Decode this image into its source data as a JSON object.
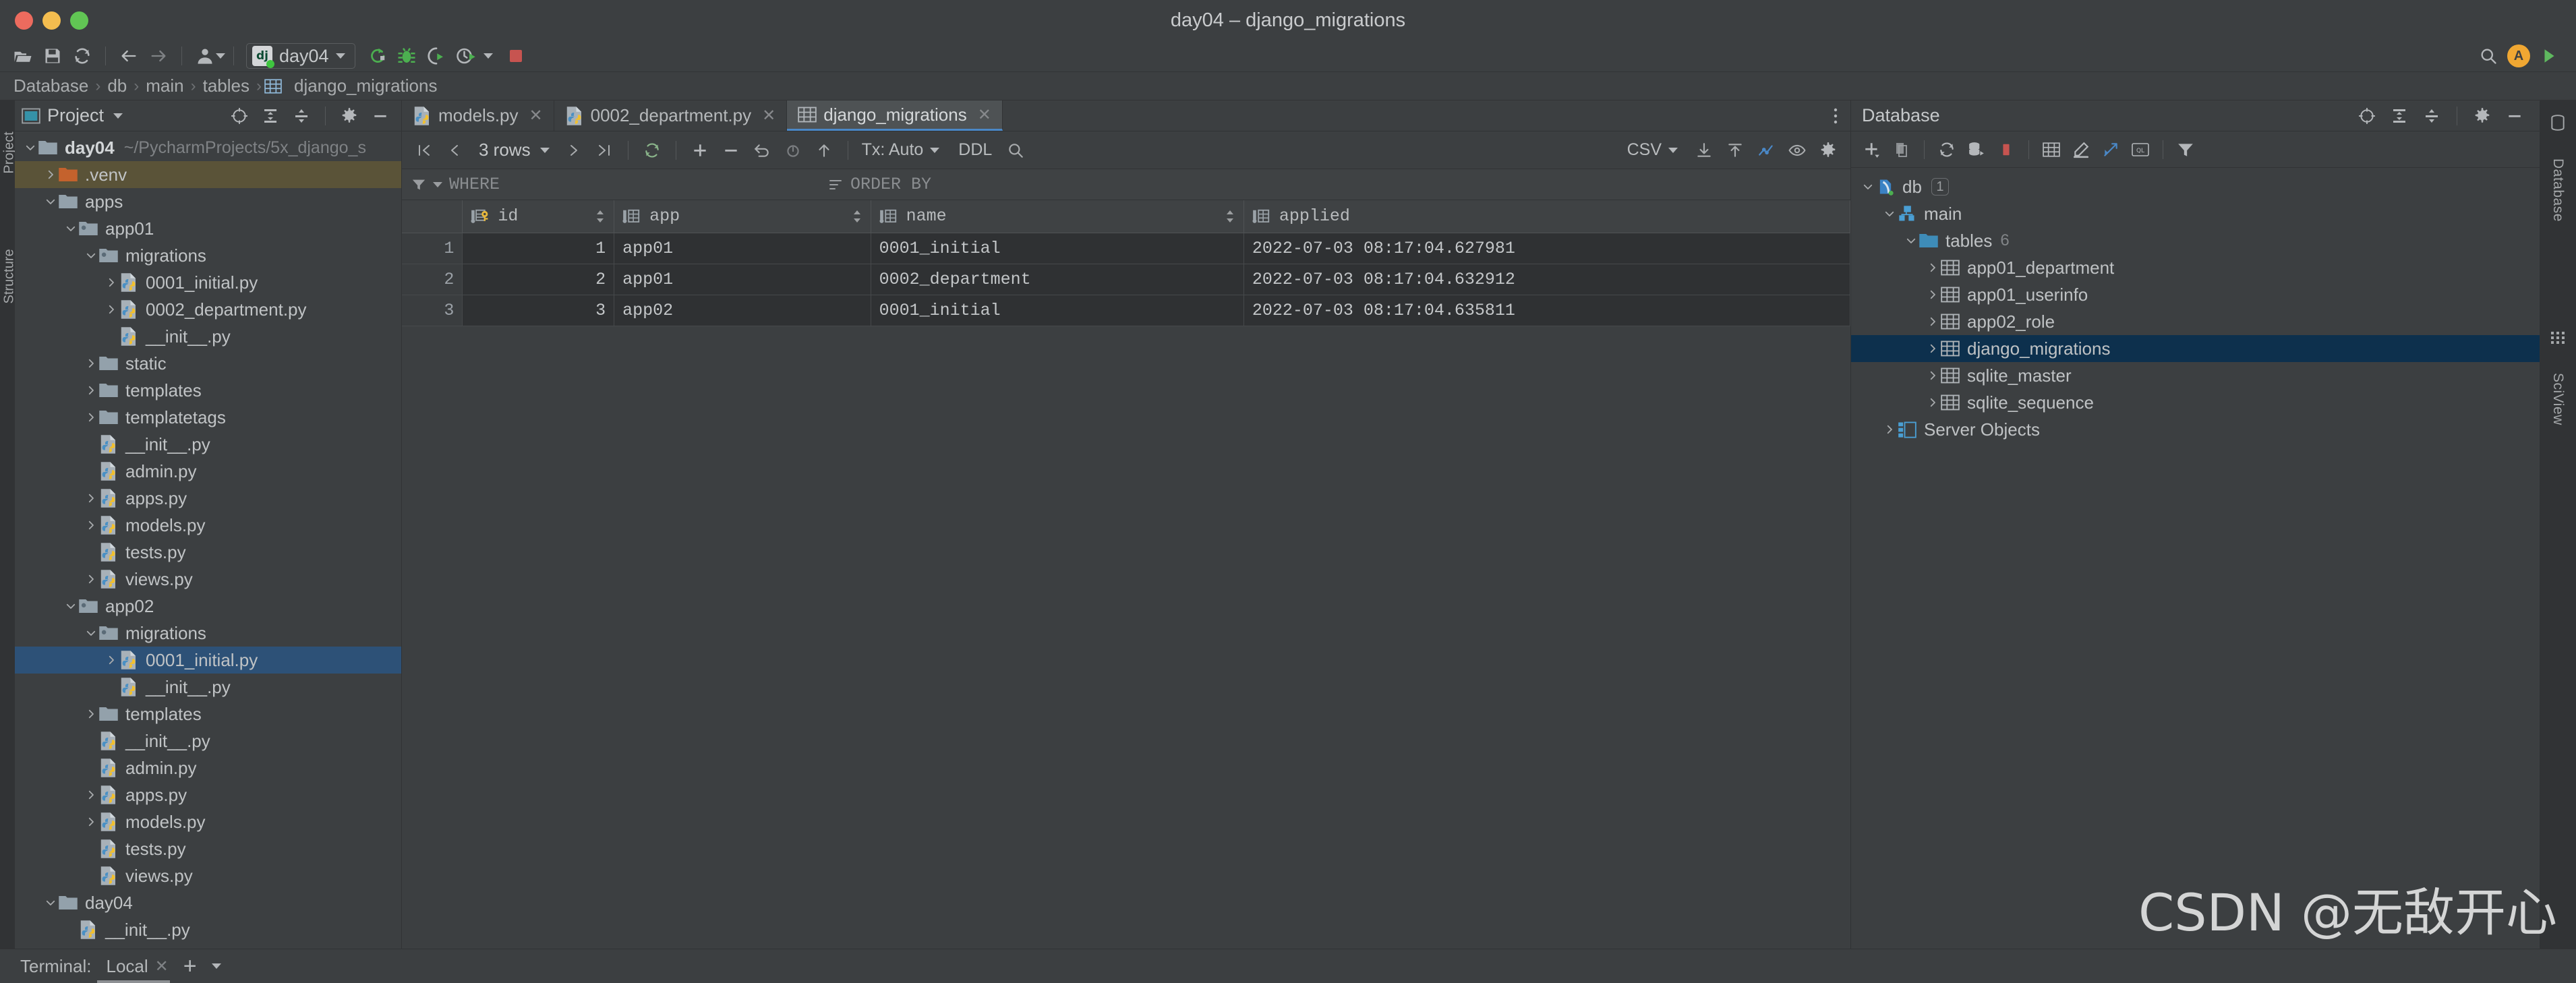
{
  "window": {
    "title": "day04 – django_migrations"
  },
  "toolbar": {
    "icons": [
      "open-folder-icon",
      "save-icon",
      "sync-icon",
      "back-arrow-icon",
      "forward-arrow-icon",
      "user-icon"
    ],
    "run_config": {
      "badge": "dj",
      "name": "day04"
    },
    "run_icons": [
      "run-icon",
      "debug-icon",
      "coverage-icon",
      "profile-icon",
      "stop-icon"
    ],
    "right_icons": [
      "search-icon",
      "avatar-icon",
      "updates-icon"
    ],
    "avatar_initial": "A"
  },
  "breadcrumb": {
    "items": [
      "Database",
      "db",
      "main",
      "tables",
      "django_migrations"
    ],
    "separator": "›"
  },
  "left_strip": {
    "labels": [
      "Project",
      "Structure"
    ]
  },
  "project_panel": {
    "title": "Project",
    "header_icons": [
      "locate-icon",
      "expand-all-icon",
      "collapse-all-icon",
      "gear-icon",
      "minimize-icon"
    ],
    "tree": [
      {
        "label": "day04",
        "path": "~/PycharmProjects/5x_django_s",
        "depth": 0,
        "arrow": "down",
        "icon": "folder-icon",
        "bold": true,
        "state": "none"
      },
      {
        "label": ".venv",
        "path": "",
        "depth": 1,
        "arrow": "right",
        "icon": "folder-venv-icon",
        "bold": false,
        "state": "sel-inactive"
      },
      {
        "label": "apps",
        "path": "",
        "depth": 1,
        "arrow": "down",
        "icon": "folder-icon",
        "bold": false,
        "state": "none"
      },
      {
        "label": "app01",
        "path": "",
        "depth": 2,
        "arrow": "down",
        "icon": "folder-module-icon",
        "bold": false,
        "state": "none"
      },
      {
        "label": "migrations",
        "path": "",
        "depth": 3,
        "arrow": "down",
        "icon": "folder-module-icon",
        "bold": false,
        "state": "none"
      },
      {
        "label": "0001_initial.py",
        "path": "",
        "depth": 4,
        "arrow": "right",
        "icon": "python-file-icon",
        "bold": false,
        "state": "none"
      },
      {
        "label": "0002_department.py",
        "path": "",
        "depth": 4,
        "arrow": "right",
        "icon": "python-file-icon",
        "bold": false,
        "state": "none"
      },
      {
        "label": "__init__.py",
        "path": "",
        "depth": 4,
        "arrow": "none",
        "icon": "python-file-icon",
        "bold": false,
        "state": "none"
      },
      {
        "label": "static",
        "path": "",
        "depth": 3,
        "arrow": "right",
        "icon": "folder-icon",
        "bold": false,
        "state": "none"
      },
      {
        "label": "templates",
        "path": "",
        "depth": 3,
        "arrow": "right",
        "icon": "folder-icon",
        "bold": false,
        "state": "none"
      },
      {
        "label": "templatetags",
        "path": "",
        "depth": 3,
        "arrow": "right",
        "icon": "folder-icon",
        "bold": false,
        "state": "none"
      },
      {
        "label": "__init__.py",
        "path": "",
        "depth": 3,
        "arrow": "none",
        "icon": "python-file-icon",
        "bold": false,
        "state": "none"
      },
      {
        "label": "admin.py",
        "path": "",
        "depth": 3,
        "arrow": "none",
        "icon": "python-file-icon",
        "bold": false,
        "state": "none"
      },
      {
        "label": "apps.py",
        "path": "",
        "depth": 3,
        "arrow": "right",
        "icon": "python-file-icon",
        "bold": false,
        "state": "none"
      },
      {
        "label": "models.py",
        "path": "",
        "depth": 3,
        "arrow": "right",
        "icon": "python-file-icon",
        "bold": false,
        "state": "none"
      },
      {
        "label": "tests.py",
        "path": "",
        "depth": 3,
        "arrow": "none",
        "icon": "python-file-icon",
        "bold": false,
        "state": "none"
      },
      {
        "label": "views.py",
        "path": "",
        "depth": 3,
        "arrow": "right",
        "icon": "python-file-icon",
        "bold": false,
        "state": "none"
      },
      {
        "label": "app02",
        "path": "",
        "depth": 2,
        "arrow": "down",
        "icon": "folder-module-icon",
        "bold": false,
        "state": "none"
      },
      {
        "label": "migrations",
        "path": "",
        "depth": 3,
        "arrow": "down",
        "icon": "folder-module-icon",
        "bold": false,
        "state": "none"
      },
      {
        "label": "0001_initial.py",
        "path": "",
        "depth": 4,
        "arrow": "right",
        "icon": "python-file-icon",
        "bold": false,
        "state": "sel-active"
      },
      {
        "label": "__init__.py",
        "path": "",
        "depth": 4,
        "arrow": "none",
        "icon": "python-file-icon",
        "bold": false,
        "state": "none"
      },
      {
        "label": "templates",
        "path": "",
        "depth": 3,
        "arrow": "right",
        "icon": "folder-icon",
        "bold": false,
        "state": "none"
      },
      {
        "label": "__init__.py",
        "path": "",
        "depth": 3,
        "arrow": "none",
        "icon": "python-file-icon",
        "bold": false,
        "state": "none"
      },
      {
        "label": "admin.py",
        "path": "",
        "depth": 3,
        "arrow": "none",
        "icon": "python-file-icon",
        "bold": false,
        "state": "none"
      },
      {
        "label": "apps.py",
        "path": "",
        "depth": 3,
        "arrow": "right",
        "icon": "python-file-icon",
        "bold": false,
        "state": "none"
      },
      {
        "label": "models.py",
        "path": "",
        "depth": 3,
        "arrow": "right",
        "icon": "python-file-icon",
        "bold": false,
        "state": "none"
      },
      {
        "label": "tests.py",
        "path": "",
        "depth": 3,
        "arrow": "none",
        "icon": "python-file-icon",
        "bold": false,
        "state": "none"
      },
      {
        "label": "views.py",
        "path": "",
        "depth": 3,
        "arrow": "none",
        "icon": "python-file-icon",
        "bold": false,
        "state": "none"
      },
      {
        "label": "day04",
        "path": "",
        "depth": 1,
        "arrow": "down",
        "icon": "folder-icon",
        "bold": false,
        "state": "none"
      },
      {
        "label": "__init__.py",
        "path": "",
        "depth": 2,
        "arrow": "none",
        "icon": "python-file-icon",
        "bold": false,
        "state": "none"
      }
    ]
  },
  "editor": {
    "tabs": [
      {
        "label": "models.py",
        "icon": "python-file-icon",
        "active": false,
        "closable": true
      },
      {
        "label": "0002_department.py",
        "icon": "python-file-icon",
        "active": false,
        "closable": true
      },
      {
        "label": "django_migrations",
        "icon": "table-icon",
        "active": true,
        "closable": true
      }
    ],
    "overflow_icon": "more-options-icon"
  },
  "grid_toolbar": {
    "first_page_icon": "first-page-icon",
    "prev_page_icon": "prev-page-icon",
    "rows_label": "3 rows",
    "next_page_icon": "next-page-icon",
    "last_page_icon": "last-page-icon",
    "reload_icon": "reload-icon",
    "add_row_icon": "add-row-icon",
    "remove_row_icon": "remove-row-icon",
    "revert_icon": "revert-icon",
    "rollback_icon": "rollback-icon",
    "submit_icon": "submit-icon",
    "tx_label": "Tx: Auto",
    "ddl_label": "DDL",
    "search_icon": "search-icon",
    "csv_label": "CSV",
    "export_icon": "export-icon",
    "import_icon": "import-icon",
    "chart_icon": "chart-icon",
    "view_icon": "eye-icon",
    "settings_icon": "gear-icon"
  },
  "filter_bar": {
    "filter_icon": "filter-icon",
    "where_label": "WHERE",
    "sort_icon": "sort-icon",
    "order_by_label": "ORDER BY"
  },
  "table_data": {
    "columns": [
      {
        "name": "id",
        "icon": "primary-key-icon"
      },
      {
        "name": "app",
        "icon": "column-icon"
      },
      {
        "name": "name",
        "icon": "column-icon"
      },
      {
        "name": "applied",
        "icon": "column-icon"
      }
    ],
    "rows": [
      {
        "n": "1",
        "id": "1",
        "app": "app01",
        "name": "0001_initial",
        "applied": "2022-07-03 08:17:04.627981"
      },
      {
        "n": "2",
        "id": "2",
        "app": "app01",
        "name": "0002_department",
        "applied": "2022-07-03 08:17:04.632912"
      },
      {
        "n": "3",
        "id": "3",
        "app": "app02",
        "name": "0001_initial",
        "applied": "2022-07-03 08:17:04.635811"
      }
    ]
  },
  "database_panel": {
    "title": "Database",
    "header_icons": [
      "locate-icon",
      "expand-all-icon",
      "collapse-all-icon",
      "gear-icon",
      "minimize-icon"
    ],
    "toolbar_icons": [
      "add-icon",
      "copy-icon",
      "refresh-icon",
      "sync-data-icon",
      "stop-icon",
      "table-icon",
      "edit-icon",
      "jump-icon",
      "query-console-icon",
      "filter-icon"
    ],
    "tree": [
      {
        "label": "db",
        "depth": 0,
        "arrow": "down",
        "icon": "sqlite-icon",
        "badge": "1",
        "count": "",
        "state": "none"
      },
      {
        "label": "main",
        "depth": 1,
        "arrow": "down",
        "icon": "schema-icon",
        "badge": "",
        "count": "",
        "state": "none"
      },
      {
        "label": "tables",
        "depth": 2,
        "arrow": "down",
        "icon": "folder-blue-icon",
        "badge": "",
        "count": "6",
        "state": "none"
      },
      {
        "label": "app01_department",
        "depth": 3,
        "arrow": "right",
        "icon": "table-icon",
        "badge": "",
        "count": "",
        "state": "none"
      },
      {
        "label": "app01_userinfo",
        "depth": 3,
        "arrow": "right",
        "icon": "table-icon",
        "badge": "",
        "count": "",
        "state": "none"
      },
      {
        "label": "app02_role",
        "depth": 3,
        "arrow": "right",
        "icon": "table-icon",
        "badge": "",
        "count": "",
        "state": "none"
      },
      {
        "label": "django_migrations",
        "depth": 3,
        "arrow": "right",
        "icon": "table-icon",
        "badge": "",
        "count": "",
        "state": "sel"
      },
      {
        "label": "sqlite_master",
        "depth": 3,
        "arrow": "right",
        "icon": "table-icon",
        "badge": "",
        "count": "",
        "state": "none"
      },
      {
        "label": "sqlite_sequence",
        "depth": 3,
        "arrow": "right",
        "icon": "table-icon",
        "badge": "",
        "count": "",
        "state": "none"
      },
      {
        "label": "Server Objects",
        "depth": 1,
        "arrow": "right",
        "icon": "server-objects-icon",
        "badge": "",
        "count": "",
        "state": "none"
      }
    ]
  },
  "right_strip": {
    "labels": [
      "Database",
      "SciView"
    ]
  },
  "bottom_bar": {
    "terminal_label": "Terminal:",
    "tab_label": "Local",
    "close_icon": "close-icon",
    "add_icon": "plus-icon",
    "dropdown_icon": "chevron-down-icon"
  },
  "watermark": {
    "text": "CSDN @无敌开心"
  },
  "colors": {
    "accent_blue": "#4a88c7",
    "selection_inactive": "#5a5338",
    "selection_active": "#2d5177",
    "db_selection": "#0d304d",
    "background": "#3c3f41",
    "grid_cell": "#2f3133"
  }
}
